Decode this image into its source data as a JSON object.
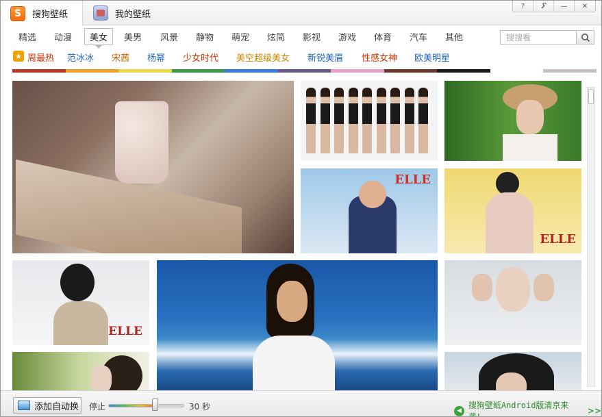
{
  "window": {
    "tabs": [
      {
        "label": "搜狗壁纸",
        "icon": "sogou-logo-icon",
        "active": true
      },
      {
        "label": "我的壁纸",
        "icon": "my-wallpaper-icon",
        "active": false
      }
    ],
    "controls": {
      "help": "?",
      "settings": "🔧",
      "minimize": "—",
      "close": "✕"
    }
  },
  "categories": [
    "精选",
    "动漫",
    "美女",
    "美男",
    "风景",
    "静物",
    "萌宠",
    "炫简",
    "影视",
    "游戏",
    "体育",
    "汽车",
    "其他"
  ],
  "active_category": "美女",
  "search": {
    "placeholder": "搜搜看"
  },
  "tags": [
    {
      "label": "周最热",
      "color": "#cc3300"
    },
    {
      "label": "范冰冰",
      "color": "#2266bb"
    },
    {
      "label": "宋茜",
      "color": "#cc6600"
    },
    {
      "label": "杨幂",
      "color": "#2266bb"
    },
    {
      "label": "少女时代",
      "color": "#cc3300"
    },
    {
      "label": "美空超级美女",
      "color": "#cc8800"
    },
    {
      "label": "新锐美眉",
      "color": "#2266bb"
    },
    {
      "label": "性感女神",
      "color": "#cc3300"
    },
    {
      "label": "欧美明星",
      "color": "#2266bb"
    }
  ],
  "color_strip": [
    "#b83a2b",
    "#f0a030",
    "#e8d84a",
    "#3a9a4a",
    "#3a7ad8",
    "#6a5a8a",
    "#e8a0c8",
    "#6a3a2a",
    "#1a1a1a",
    "#ffffff",
    "#c8c0c0"
  ],
  "tiles": [
    {
      "name": "tile-book-and-cup",
      "overlay": ""
    },
    {
      "name": "tile-girl-group",
      "overlay": ""
    },
    {
      "name": "tile-sun-hat",
      "overlay": ""
    },
    {
      "name": "tile-cap-jacket",
      "overlay": "ELLE"
    },
    {
      "name": "tile-yellow-wall",
      "overlay": "ELLE"
    },
    {
      "name": "tile-short-hair",
      "overlay": "ELLE"
    },
    {
      "name": "tile-beach",
      "overlay": ""
    },
    {
      "name": "tile-hands-face",
      "overlay": ""
    },
    {
      "name": "tile-headphones",
      "overlay": ""
    },
    {
      "name": "tile-dark-hair",
      "overlay": ""
    }
  ],
  "bottom": {
    "add_button": "添加自动换",
    "stop_label": "停止",
    "interval_label": "30 秒",
    "interval_fraction": 0.62,
    "promo": "搜狗壁纸Android版清京来袭！",
    "promo_arrow": ">>"
  }
}
